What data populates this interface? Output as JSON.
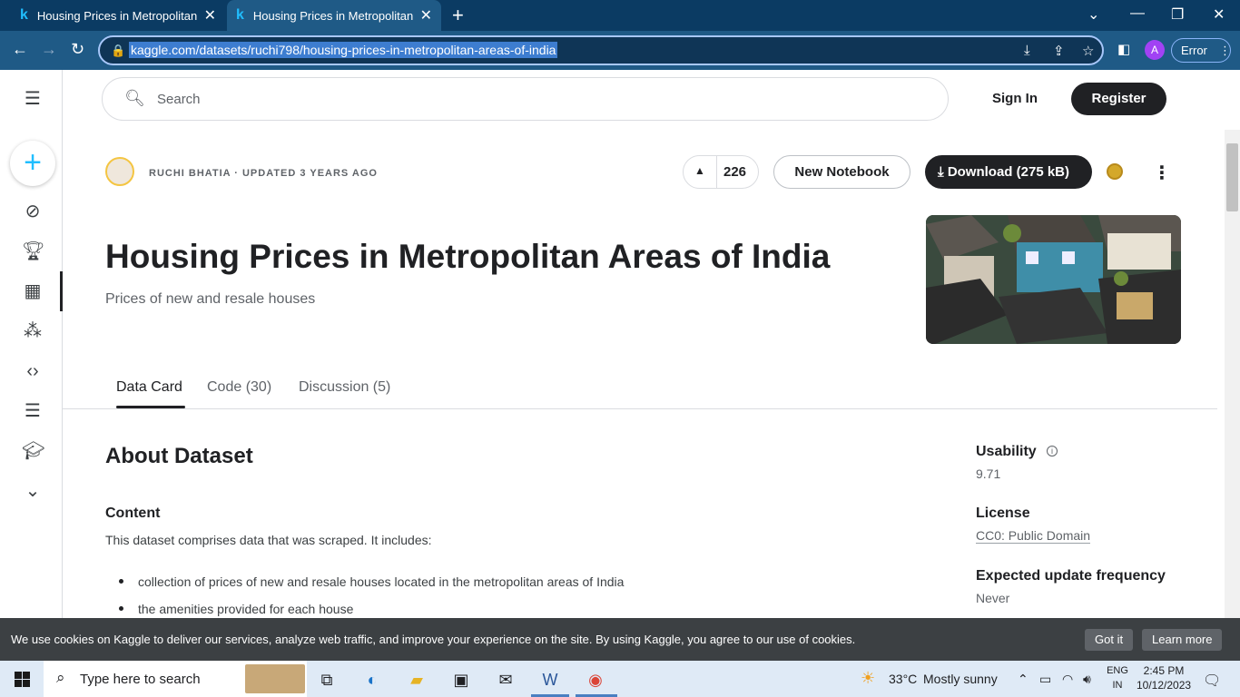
{
  "browser": {
    "tabs": [
      {
        "title": "Housing Prices in Metropolitan A"
      },
      {
        "title": "Housing Prices in Metropolitan A"
      }
    ],
    "url": "kaggle.com/datasets/ruchi798/housing-prices-in-metropolitan-areas-of-india",
    "profile_initial": "A",
    "error_label": "Error"
  },
  "header": {
    "search_placeholder": "Search",
    "sign_in": "Sign In",
    "register": "Register"
  },
  "dataset": {
    "owner_meta": "RUCHI BHATIA · UPDATED 3 YEARS AGO",
    "votes": "226",
    "new_notebook": "New Notebook",
    "download": "Download (275 kB)",
    "title": "Housing Prices in Metropolitan Areas of India",
    "subtitle": "Prices of new and resale houses"
  },
  "tabs": [
    {
      "label": "Data Card"
    },
    {
      "label": "Code (30)"
    },
    {
      "label": "Discussion (5)"
    }
  ],
  "about": {
    "heading": "About Dataset",
    "content_heading": "Content",
    "description": "This dataset comprises data that was scraped. It includes:",
    "bullets": [
      "collection of prices of new and resale houses located in the metropolitan areas of India",
      "the amenities provided for each house"
    ]
  },
  "sidebar": {
    "usability_label": "Usability",
    "usability_value": "9.71",
    "license_label": "License",
    "license_value": "CC0: Public Domain",
    "frequency_label": "Expected update frequency",
    "frequency_value": "Never"
  },
  "cookie": {
    "text": "We use cookies on Kaggle to deliver our services, analyze web traffic, and improve your experience on the site. By using Kaggle, you agree to our use of cookies.",
    "got_it": "Got it",
    "learn_more": "Learn more"
  },
  "taskbar": {
    "search_placeholder": "Type here to search",
    "weather_temp": "33°C",
    "weather_text": "Mostly sunny",
    "lang_top": "ENG",
    "lang_bottom": "IN",
    "time": "2:45 PM",
    "date": "10/12/2023"
  }
}
